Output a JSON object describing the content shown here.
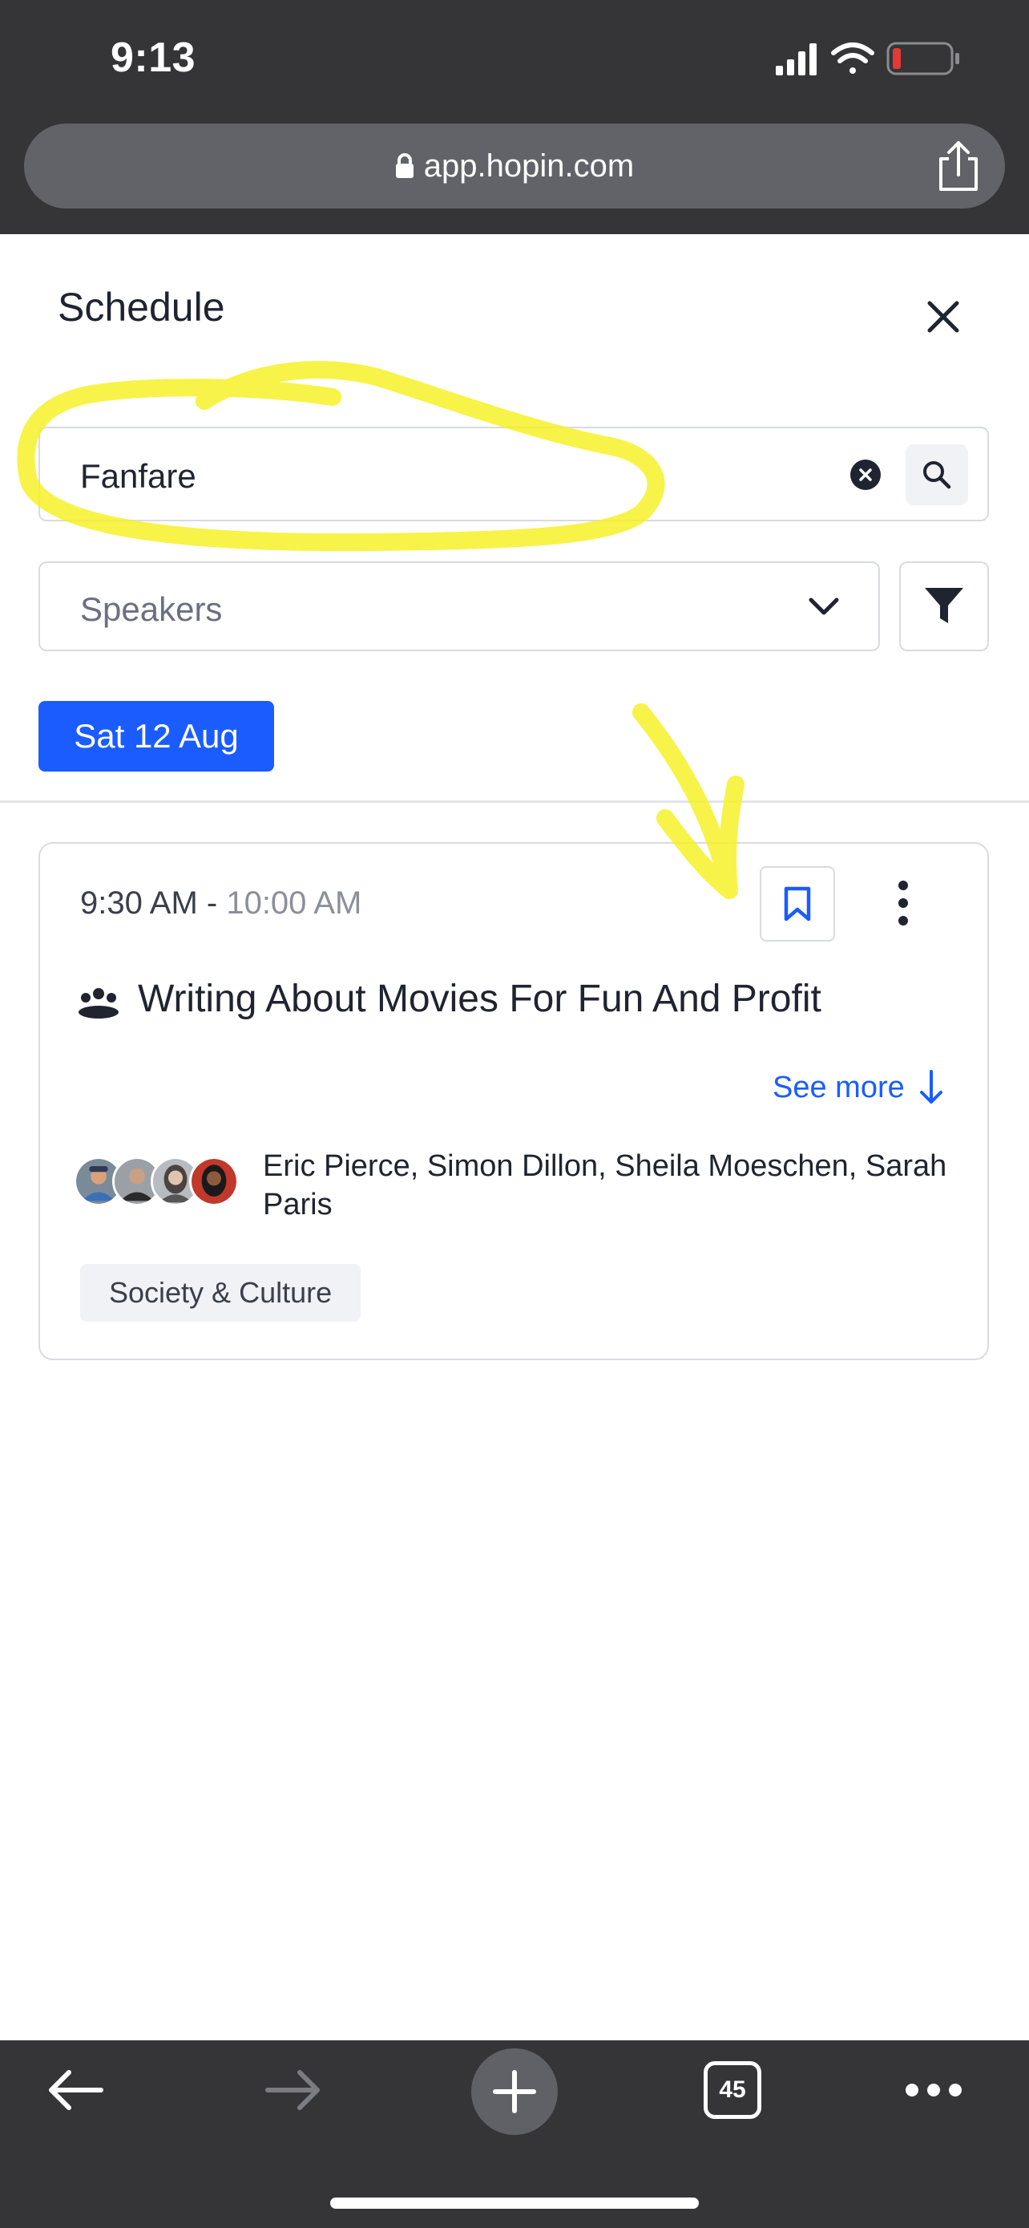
{
  "status_bar": {
    "time": "9:13"
  },
  "browser": {
    "url": "app.hopin.com",
    "tab_count": "45"
  },
  "schedule": {
    "title": "Schedule",
    "search": {
      "value": "Fanfare"
    },
    "speakers_filter": {
      "label": "Speakers"
    },
    "date_tab": "Sat 12 Aug"
  },
  "session": {
    "start_time": "9:30 AM -",
    "end_time": "10:00 AM",
    "title": "Writing About Movies For Fun And Profit",
    "see_more": "See more",
    "speakers": "Eric Pierce, Simon Dillon, Sheila Moeschen, Sarah Paris",
    "tag": "Society & Culture"
  },
  "colors": {
    "accent": "#1a5cff",
    "chrome": "#353538",
    "annotation": "#f5f020",
    "battery_low": "#e53935"
  },
  "icons": [
    "lock-icon",
    "share-icon",
    "close-icon",
    "clear-icon",
    "search-icon",
    "chevron-down-icon",
    "filter-icon",
    "bookmark-icon",
    "more-vertical-icon",
    "group-icon",
    "arrow-down-icon",
    "back-arrow-icon",
    "forward-arrow-icon",
    "plus-icon",
    "menu-dots-icon"
  ]
}
